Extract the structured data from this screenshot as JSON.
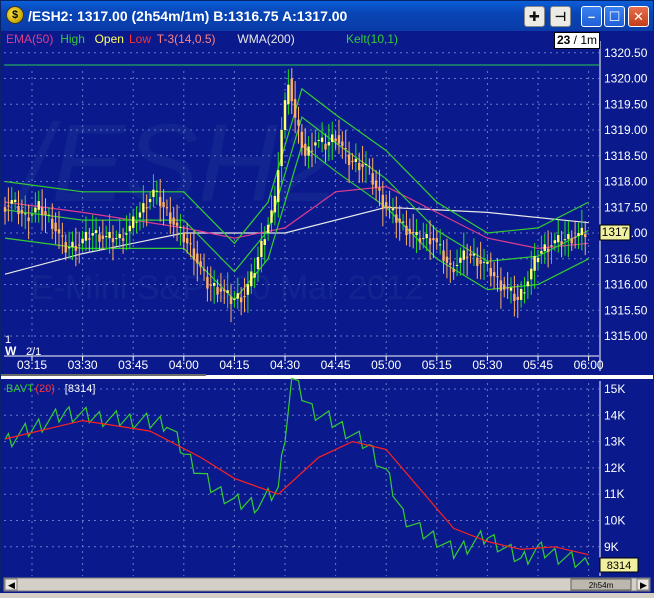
{
  "window": {
    "title": "/ESH2: 1317.00 (2h54m/1m)  B:1316.75  A:1317.00",
    "app_icon": "trading-app-icon",
    "toolbar_buttons": [
      "crosshair-icon",
      "pin-icon",
      "minimize-icon",
      "maximize-icon",
      "close-icon"
    ]
  },
  "price_panel": {
    "watermark": "/ESH2",
    "watermark_sub": "E-Mini S&P 500 Mar 2012",
    "bar_counter": "23",
    "interval": "/ 1m",
    "last_price_label": "1317",
    "date_label": "2/1",
    "week_label": "W",
    "left_marker": "1",
    "legend": [
      {
        "text": "EMA(50)",
        "color": "#e03c8c"
      },
      {
        "text": "High",
        "color": "#33cc33"
      },
      {
        "text": "Open",
        "color": "#ffff66"
      },
      {
        "text": "Low",
        "color": "#ff3030"
      },
      {
        "text": "T-3(14,0.5)",
        "color": "#ff8080"
      },
      {
        "text": "WMA(200)",
        "color": "#e8e8e8"
      },
      {
        "text": "Kelt(10,1)",
        "color": "#33cc33"
      }
    ]
  },
  "volume_panel": {
    "legend": [
      {
        "text": "BAVT",
        "color": "#33cc33"
      },
      {
        "text": "(20)",
        "color": "#ff3030"
      },
      {
        "text": "[8314]",
        "color": "#ffffff"
      }
    ],
    "last_value_label": "8314",
    "scrollbar_label": "2h54m"
  },
  "colors": {
    "background": "#0a1a8c",
    "up_candle": "#ffff66",
    "down_candle": "#ffb060",
    "wick_up": "#22dd22",
    "ema": "#e03c8c",
    "wma": "#e8e8e8",
    "keltner": "#33cc33",
    "volume_line": "#33cc33",
    "volume_avg": "#ff2020"
  },
  "chart_data": [
    {
      "type": "candlestick",
      "title": "/ESH2 1m",
      "x_tick_labels": [
        "03:15",
        "03:30",
        "03:45",
        "04:00",
        "04:15",
        "04:30",
        "04:45",
        "05:00",
        "05:15",
        "05:30",
        "05:45",
        "06:00"
      ],
      "y_tick_labels": [
        "1320.50",
        "1320.00",
        "1319.50",
        "1319.00",
        "1318.50",
        "1318.00",
        "1317.50",
        "1317.00",
        "1316.50",
        "1316.00",
        "1315.50",
        "1315.00"
      ],
      "ylim": [
        1315.0,
        1320.5
      ],
      "close_series": [
        [
          "03:07",
          1317.5
        ],
        [
          "03:10",
          1317.6
        ],
        [
          "03:14",
          1317.3
        ],
        [
          "03:18",
          1317.5
        ],
        [
          "03:22",
          1317.2
        ],
        [
          "03:26",
          1316.7
        ],
        [
          "03:30",
          1316.8
        ],
        [
          "03:34",
          1317.0
        ],
        [
          "03:38",
          1316.9
        ],
        [
          "03:42",
          1316.9
        ],
        [
          "03:45",
          1317.1
        ],
        [
          "03:48",
          1317.4
        ],
        [
          "03:52",
          1317.8
        ],
        [
          "03:56",
          1317.4
        ],
        [
          "04:00",
          1317.0
        ],
        [
          "04:04",
          1316.6
        ],
        [
          "04:08",
          1316.0
        ],
        [
          "04:12",
          1315.9
        ],
        [
          "04:15",
          1315.7
        ],
        [
          "04:19",
          1315.8
        ],
        [
          "04:22",
          1316.3
        ],
        [
          "04:25",
          1317.0
        ],
        [
          "04:28",
          1317.6
        ],
        [
          "04:30",
          1319.0
        ],
        [
          "04:32",
          1320.0
        ],
        [
          "04:34",
          1319.2
        ],
        [
          "04:37",
          1318.5
        ],
        [
          "04:40",
          1318.8
        ],
        [
          "04:43",
          1318.7
        ],
        [
          "04:46",
          1318.9
        ],
        [
          "04:50",
          1318.4
        ],
        [
          "04:55",
          1318.3
        ],
        [
          "05:00",
          1317.6
        ],
        [
          "05:05",
          1317.2
        ],
        [
          "05:10",
          1316.9
        ],
        [
          "05:15",
          1316.9
        ],
        [
          "05:20",
          1316.3
        ],
        [
          "05:25",
          1316.6
        ],
        [
          "05:30",
          1316.4
        ],
        [
          "05:35",
          1316.0
        ],
        [
          "05:40",
          1315.7
        ],
        [
          "05:43",
          1316.1
        ],
        [
          "05:46",
          1316.6
        ],
        [
          "05:50",
          1316.8
        ],
        [
          "05:55",
          1316.9
        ],
        [
          "06:00",
          1317.0
        ]
      ],
      "series": [
        {
          "name": "EMA(50)",
          "points": [
            [
              "03:07",
              1317.6
            ],
            [
              "03:30",
              1317.4
            ],
            [
              "04:00",
              1317.1
            ],
            [
              "04:15",
              1316.9
            ],
            [
              "04:30",
              1317.1
            ],
            [
              "04:45",
              1317.8
            ],
            [
              "05:00",
              1317.9
            ],
            [
              "05:15",
              1317.4
            ],
            [
              "05:30",
              1316.9
            ],
            [
              "05:45",
              1316.7
            ],
            [
              "06:00",
              1316.8
            ]
          ]
        },
        {
          "name": "WMA(200)",
          "points": [
            [
              "03:07",
              1316.2
            ],
            [
              "03:30",
              1316.6
            ],
            [
              "04:00",
              1317.0
            ],
            [
              "04:30",
              1317.0
            ],
            [
              "05:00",
              1317.5
            ],
            [
              "05:30",
              1317.4
            ],
            [
              "06:00",
              1317.2
            ]
          ]
        },
        {
          "name": "Kelt(10,1)",
          "points": [
            [
              "03:07",
              1318.0
            ],
            [
              "03:30",
              1317.8
            ],
            [
              "04:00",
              1317.8
            ],
            [
              "04:15",
              1316.8
            ],
            [
              "04:25",
              1317.6
            ],
            [
              "04:35",
              1319.8
            ],
            [
              "04:45",
              1319.3
            ],
            [
              "05:00",
              1318.6
            ],
            [
              "05:15",
              1317.6
            ],
            [
              "05:30",
              1317.0
            ],
            [
              "05:45",
              1317.1
            ],
            [
              "06:00",
              1317.6
            ]
          ]
        }
      ]
    },
    {
      "type": "line",
      "title": "BAVT",
      "y_tick_labels": [
        "15K",
        "14K",
        "13K",
        "12K",
        "11K",
        "10K",
        "9K"
      ],
      "ylim": [
        8000,
        15500
      ],
      "series": [
        {
          "name": "BAVT",
          "points": [
            [
              "03:07",
              13000
            ],
            [
              "03:15",
              13500
            ],
            [
              "03:25",
              14100
            ],
            [
              "03:35",
              13900
            ],
            [
              "03:45",
              13800
            ],
            [
              "03:55",
              13700
            ],
            [
              "04:00",
              12600
            ],
            [
              "04:08",
              11300
            ],
            [
              "04:15",
              10700
            ],
            [
              "04:22",
              10600
            ],
            [
              "04:28",
              11200
            ],
            [
              "04:32",
              15400
            ],
            [
              "04:38",
              14200
            ],
            [
              "04:45",
              13700
            ],
            [
              "04:55",
              12800
            ],
            [
              "05:00",
              11800
            ],
            [
              "05:05",
              10200
            ],
            [
              "05:10",
              9600
            ],
            [
              "05:15",
              9300
            ],
            [
              "05:20",
              8800
            ],
            [
              "05:30",
              9400
            ],
            [
              "05:40",
              8500
            ],
            [
              "05:45",
              8900
            ],
            [
              "05:50",
              8700
            ],
            [
              "06:00",
              8300
            ]
          ]
        },
        {
          "name": "(20)",
          "points": [
            [
              "03:07",
              13100
            ],
            [
              "03:30",
              13800
            ],
            [
              "03:50",
              13400
            ],
            [
              "04:05",
              12400
            ],
            [
              "04:15",
              11600
            ],
            [
              "04:28",
              11000
            ],
            [
              "04:40",
              12400
            ],
            [
              "04:50",
              13000
            ],
            [
              "05:00",
              12700
            ],
            [
              "05:10",
              11200
            ],
            [
              "05:20",
              9700
            ],
            [
              "05:30",
              9200
            ],
            [
              "05:40",
              8900
            ],
            [
              "05:50",
              9000
            ],
            [
              "06:00",
              8700
            ]
          ]
        }
      ]
    }
  ]
}
